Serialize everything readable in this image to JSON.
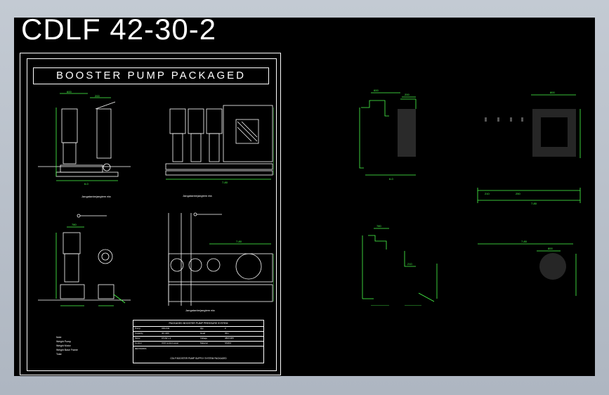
{
  "drawing": {
    "title": "CDLF 42-30-2",
    "banner": "BOOSTER PUMP PACKAGED",
    "captions": {
      "top_left": "Jangatanbejangtem ela",
      "top_right": "Jangatanbejangtem ela",
      "mid": "Jangatanbejangtem ela"
    },
    "dim_labels": {
      "d600": "600",
      "d200": "200",
      "d780": "780",
      "d7800": "7-80",
      "d800": "800",
      "d210": "210",
      "d250": "250",
      "d6": "6-0"
    },
    "title_block": {
      "header": "PACKAGED BOOSTER PUMP PRESSURE SYSTEM",
      "rows": [
        {
          "a": "Pump",
          "b": "CDLF42",
          "c": "Qty",
          "d": "2"
        },
        {
          "a": "Capacity",
          "b": "42 m3/h",
          "c": "Head",
          "d": "30m"
        },
        {
          "a": "Motor",
          "b": "15 kW x 2",
          "c": "Voltage",
          "d": "380V/3Ph"
        },
        {
          "a": "Control",
          "b": "VFD control panel",
          "c": "Material",
          "d": "SS304"
        }
      ],
      "rev_label": "REVISIONS",
      "description": "CDLF BOOSTER PUMP SUPPLY SYSTEM PACKAGED"
    },
    "notes": [
      "Note",
      "Weight Pump",
      "Weight Motor",
      "Weight Base Frame",
      "Total"
    ]
  },
  "colors": {
    "background": "#000000",
    "linework": "#ffffff",
    "dimension": "#4aff4a",
    "app_border": "#b9c0c9"
  }
}
